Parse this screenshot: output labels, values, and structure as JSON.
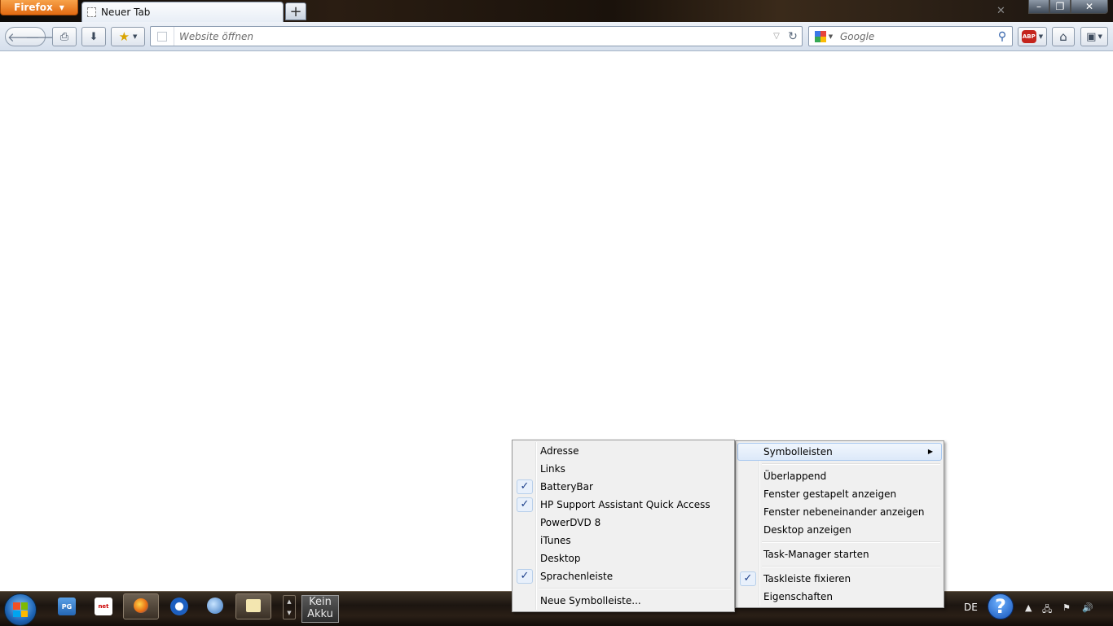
{
  "browser": {
    "app_button": "Firefox",
    "tab_title": "Neuer Tab",
    "new_tab_label": "+",
    "window": {
      "minimize": "–",
      "maximize": "❐",
      "close": "✕"
    },
    "url_placeholder": "Website öffnen",
    "search_placeholder": "Google",
    "abp_label": "ABP"
  },
  "icons": {
    "back": "back-arrow-icon",
    "forward": "forward-arrow-icon",
    "print": "printer-icon",
    "download": "download-arrow-icon",
    "bookmark": "star-icon",
    "reload": "reload-icon",
    "search_go": "magnifier-icon",
    "home": "home-icon",
    "addon": "addon-bar-icon"
  },
  "taskbar_menu": {
    "items": [
      "Symbolleisten",
      "Überlappend",
      "Fenster gestapelt anzeigen",
      "Fenster nebeneinander anzeigen",
      "Desktop anzeigen",
      "Task-Manager starten",
      "Taskleiste fixieren",
      "Eigenschaften"
    ]
  },
  "toolbars_menu": {
    "items": [
      "Adresse",
      "Links",
      "BatteryBar",
      "HP Support Assistant Quick Access",
      "PowerDVD 8",
      "iTunes",
      "Desktop",
      "Sprachenleiste",
      "Neue Symbolleiste..."
    ]
  },
  "taskbar": {
    "pg_icon": "PG",
    "net_icon": "net",
    "battery_line1": "Kein",
    "battery_line2": "Akku",
    "language": "DE",
    "help": "?"
  },
  "colors": {
    "firefox_orange": "#e66a12",
    "menu_bg": "#f0f0f0",
    "highlight": "#dde9f9"
  }
}
